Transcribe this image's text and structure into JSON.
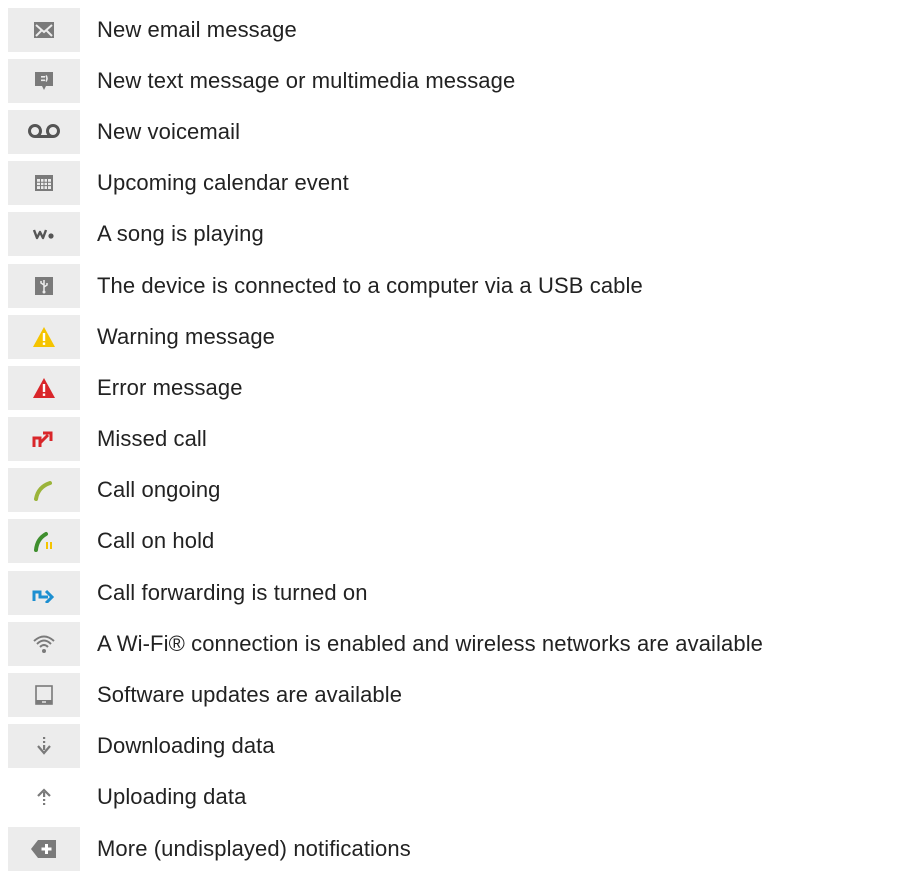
{
  "items": [
    {
      "icon": "email-icon",
      "label": "New email message"
    },
    {
      "icon": "text-message-icon",
      "label": "New text message or multimedia message"
    },
    {
      "icon": "voicemail-icon",
      "label": "New voicemail"
    },
    {
      "icon": "calendar-icon",
      "label": "Upcoming calendar event"
    },
    {
      "icon": "walkman-icon",
      "label": "A song is playing"
    },
    {
      "icon": "usb-icon",
      "label": "The device is connected to a computer via a USB cable"
    },
    {
      "icon": "warning-icon",
      "label": "Warning message"
    },
    {
      "icon": "error-icon",
      "label": "Error message"
    },
    {
      "icon": "missed-call-icon",
      "label": "Missed call"
    },
    {
      "icon": "call-ongoing-icon",
      "label": "Call ongoing"
    },
    {
      "icon": "call-on-hold-icon",
      "label": "Call on hold"
    },
    {
      "icon": "call-forwarding-icon",
      "label": "Call forwarding is turned on"
    },
    {
      "icon": "wifi-icon",
      "label": "A Wi-Fi® connection is enabled and wireless networks are available"
    },
    {
      "icon": "software-update-icon",
      "label": "Software updates are available"
    },
    {
      "icon": "download-icon",
      "label": "Downloading data"
    },
    {
      "icon": "upload-icon",
      "label": "Uploading data"
    },
    {
      "icon": "more-notifications-icon",
      "label": "More (undisplayed) notifications"
    }
  ],
  "colors": {
    "icon_bg": "#ececec",
    "icon_gray": "#7a7a7a",
    "warning": "#f5c400",
    "error": "#d9262a",
    "call_green": "#9bb43a",
    "call_hold_green": "#3f8f2e",
    "forward_blue": "#1c8fd1"
  }
}
